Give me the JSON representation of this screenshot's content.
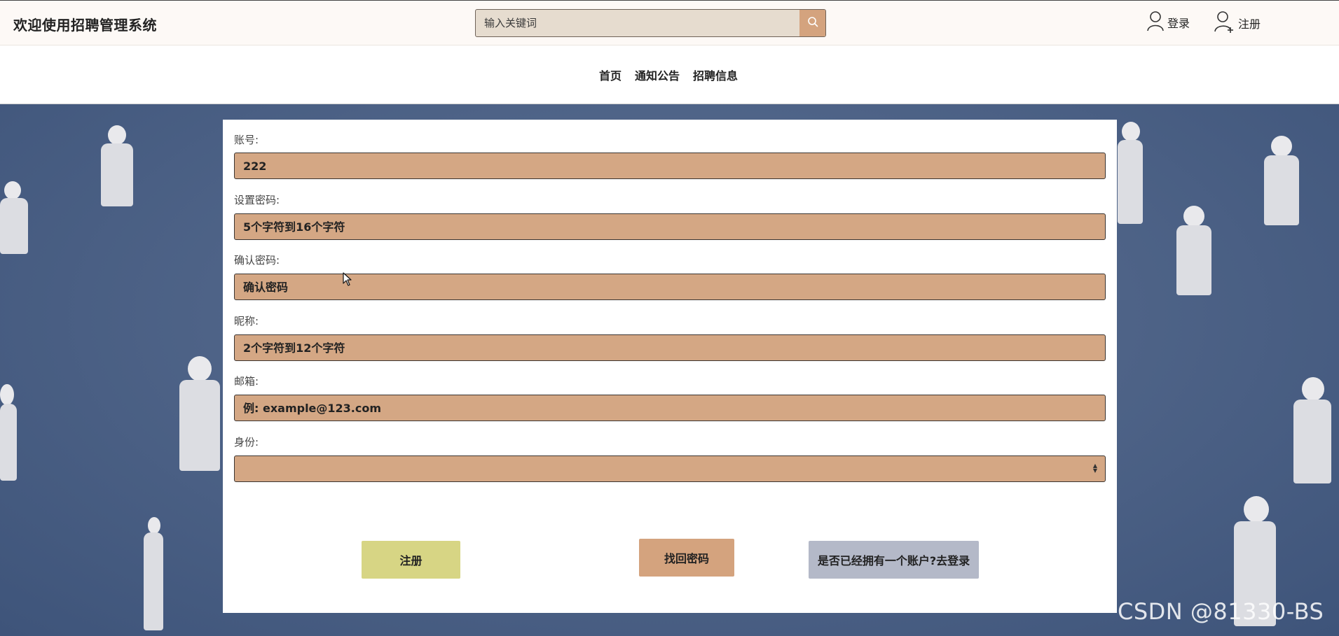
{
  "header": {
    "title": "欢迎使用招聘管理系统",
    "search_placeholder": "输入关键词",
    "login_label": "登录",
    "register_label": "注册"
  },
  "nav": {
    "items": [
      "首页",
      "通知公告",
      "招聘信息"
    ]
  },
  "form": {
    "account": {
      "label": "账号:",
      "value": "222"
    },
    "password": {
      "label": "设置密码:",
      "placeholder": "5个字符到16个字符"
    },
    "confirm_password": {
      "label": "确认密码:",
      "placeholder": "确认密码"
    },
    "nickname": {
      "label": "昵称:",
      "placeholder": "2个字符到12个字符"
    },
    "email": {
      "label": "邮箱:",
      "placeholder": "例: example@123.com"
    },
    "identity": {
      "label": "身份:",
      "value": ""
    }
  },
  "buttons": {
    "register": "注册",
    "recover": "找回密码",
    "goto_login": "是否已经拥有一个账户?去登录"
  },
  "colors": {
    "input_bg": "#d4a784",
    "register_btn": "#d7d584",
    "recover_btn": "#d4a37e",
    "login_btn": "#b4b9c8"
  },
  "watermark": "CSDN @81330-BS"
}
